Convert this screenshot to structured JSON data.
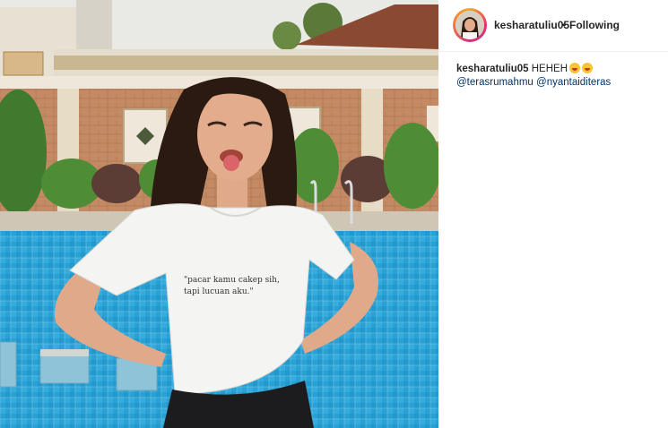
{
  "post": {
    "username": "kesharatuliu05",
    "separator": "•",
    "follow_status": "Following",
    "caption_username": "kesharatuliu05",
    "caption_text": "HEHEH",
    "emojis": [
      "grinning-tongue-emoji",
      "grinning-tongue-emoji"
    ],
    "mentions": [
      "@terasrumahmu",
      "@nyantaiditeras"
    ]
  },
  "photo": {
    "shirt_text_line1": "\"pacar kamu cakep sih,",
    "shirt_text_line2": "tapi lucuan aku.\""
  },
  "colors": {
    "pool_water": "#2a9fd0",
    "brick_wall": "#c9916a",
    "shirt": "#f4f4f2",
    "hair": "#2b1a12"
  }
}
